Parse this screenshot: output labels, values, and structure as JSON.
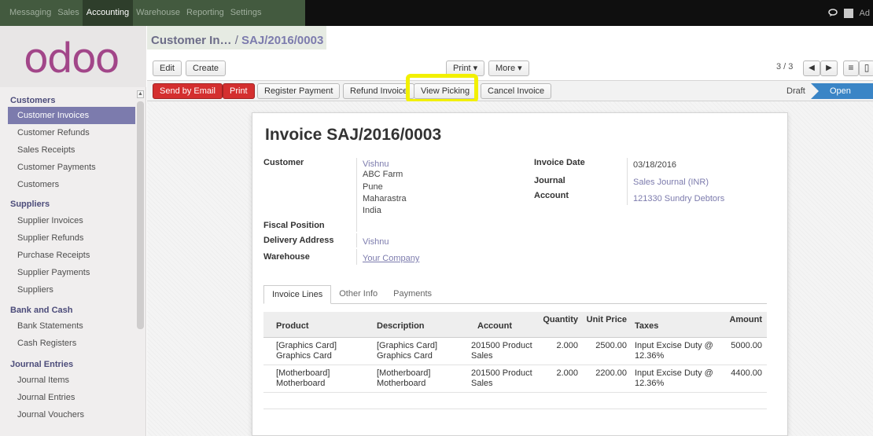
{
  "topbar": {
    "menus": [
      "Messaging",
      "Sales",
      "Accounting",
      "Warehouse",
      "Reporting",
      "Settings"
    ],
    "active_menu": "Accounting",
    "user_initial": "Ad"
  },
  "logo": "odoo",
  "sidebar": {
    "sections": [
      {
        "title": "Customers",
        "items": [
          "Customer Invoices",
          "Customer Refunds",
          "Sales Receipts",
          "Customer Payments",
          "Customers"
        ]
      },
      {
        "title": "Suppliers",
        "items": [
          "Supplier Invoices",
          "Supplier Refunds",
          "Purchase Receipts",
          "Supplier Payments",
          "Suppliers"
        ]
      },
      {
        "title": "Bank and Cash",
        "items": [
          "Bank Statements",
          "Cash Registers"
        ]
      },
      {
        "title": "Journal Entries",
        "items": [
          "Journal Items",
          "Journal Entries",
          "Journal Vouchers"
        ]
      }
    ],
    "active_item": "Customer Invoices"
  },
  "breadcrumb": {
    "parent": "Customer In…",
    "separator": "/",
    "current": "SAJ/2016/0003"
  },
  "toolbar": {
    "edit": "Edit",
    "create": "Create",
    "print": "Print ▾",
    "more": "More ▾",
    "pager": "3 / 3"
  },
  "actions": {
    "send_by_email": "Send by Email",
    "print": "Print",
    "register_payment": "Register Payment",
    "refund_invoice": "Refund Invoice",
    "view_picking": "View Picking",
    "cancel_invoice": "Cancel Invoice",
    "status_draft": "Draft",
    "status_open": "Open"
  },
  "invoice": {
    "title": "Invoice SAJ/2016/0003",
    "customer_label": "Customer",
    "customer_name": "Vishnu",
    "customer_address": [
      "ABC Farm",
      "Pune",
      "Maharastra",
      "India"
    ],
    "fiscal_position_label": "Fiscal Position",
    "delivery_address_label": "Delivery Address",
    "delivery_address": "Vishnu",
    "warehouse_label": "Warehouse",
    "warehouse": "Your Company",
    "invoice_date_label": "Invoice Date",
    "invoice_date": "03/18/2016",
    "journal_label": "Journal",
    "journal": "Sales Journal (INR)",
    "account_label": "Account",
    "account": "121330 Sundry Debtors"
  },
  "tabs": [
    "Invoice Lines",
    "Other Info",
    "Payments"
  ],
  "lines": {
    "headers": [
      "Product",
      "Description",
      "Account",
      "Quantity",
      "Unit Price",
      "Taxes",
      "Amount"
    ],
    "rows": [
      [
        "[Graphics Card] Graphics Card",
        "[Graphics Card] Graphics Card",
        "201500 Product Sales",
        "2.000",
        "2500.00",
        "Input Excise Duty @ 12.36%",
        "5000.00"
      ],
      [
        "[Motherboard] Motherboard",
        "[Motherboard] Motherboard",
        "201500 Product Sales",
        "2.000",
        "2200.00",
        "Input Excise Duty @ 12.36%",
        "4400.00"
      ]
    ]
  },
  "colors": {
    "accent": "#7c7bad",
    "logo": "#a24689",
    "danger_button": "#d42f2f",
    "status_open": "#3a85c6",
    "highlight": "#f2f000"
  }
}
